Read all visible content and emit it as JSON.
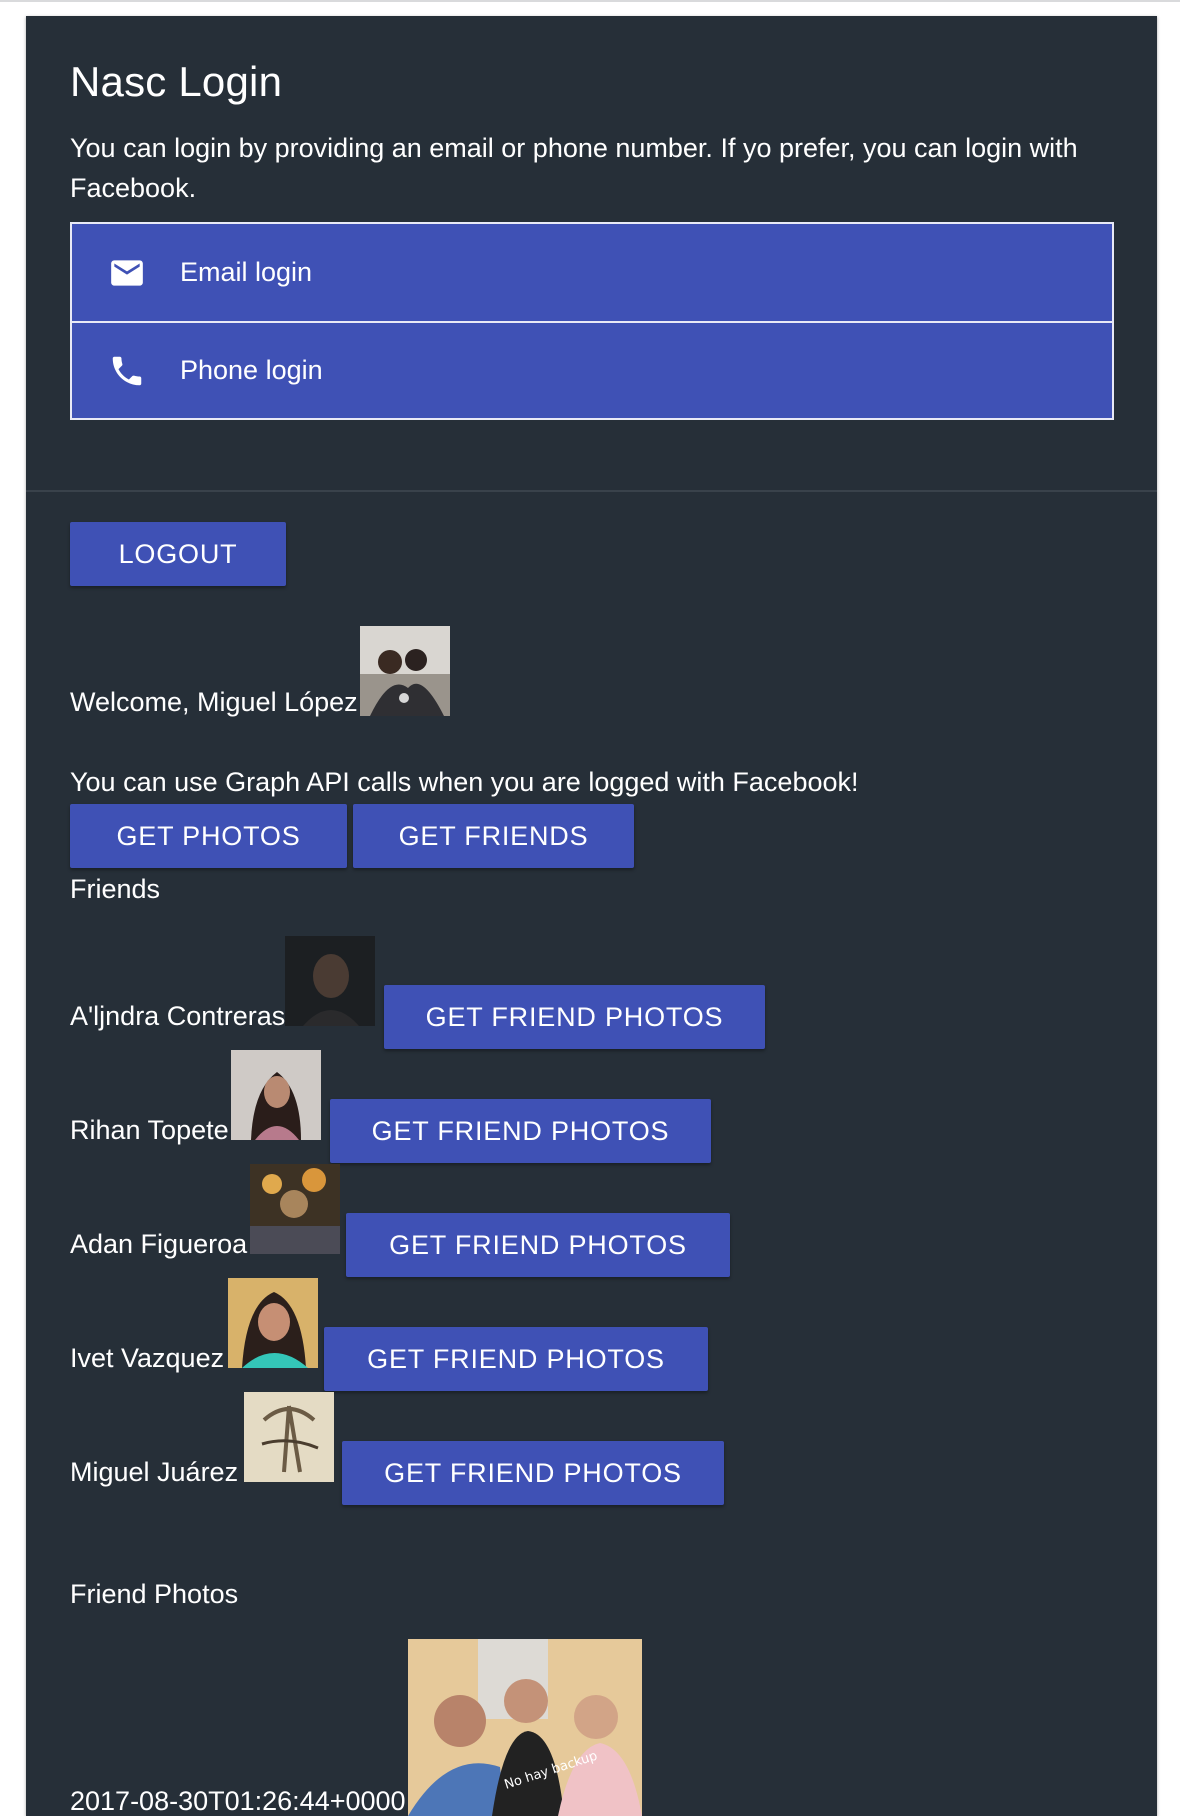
{
  "page": {
    "title": "Nasc Login",
    "intro": "You can login by providing an email or phone number. If yo prefer, you can login with Facebook."
  },
  "login_options": [
    {
      "label": "Email login",
      "icon": "mail-icon"
    },
    {
      "label": "Phone login",
      "icon": "phone-icon"
    }
  ],
  "session": {
    "logout_label": "LOGOUT",
    "welcome": "Welcome, Miguel López"
  },
  "graph": {
    "intro": "You can use Graph API calls when you are logged with Facebook!",
    "get_photos_label": "GET PHOTOS",
    "get_friends_label": "GET FRIENDS",
    "friends_heading": "Friends"
  },
  "friends": [
    {
      "name": "A'ljndra Contreras",
      "button_label": "GET FRIEND PHOTOS"
    },
    {
      "name": "Rihan Topete",
      "button_label": "GET FRIEND PHOTOS"
    },
    {
      "name": "Adan Figueroa",
      "button_label": "GET FRIEND PHOTOS"
    },
    {
      "name": "Ivet Vazquez",
      "button_label": "GET FRIEND PHOTOS"
    },
    {
      "name": "Miguel Juárez",
      "button_label": "GET FRIEND PHOTOS"
    }
  ],
  "friend_photos": {
    "heading": "Friend Photos",
    "items": [
      {
        "timestamp": "2017-08-30T01:26:44+0000",
        "shirt_text": "No hay backup"
      }
    ]
  },
  "theme": {
    "background": "#262f38",
    "primary": "#3f51b5",
    "text": "#ffffff"
  }
}
